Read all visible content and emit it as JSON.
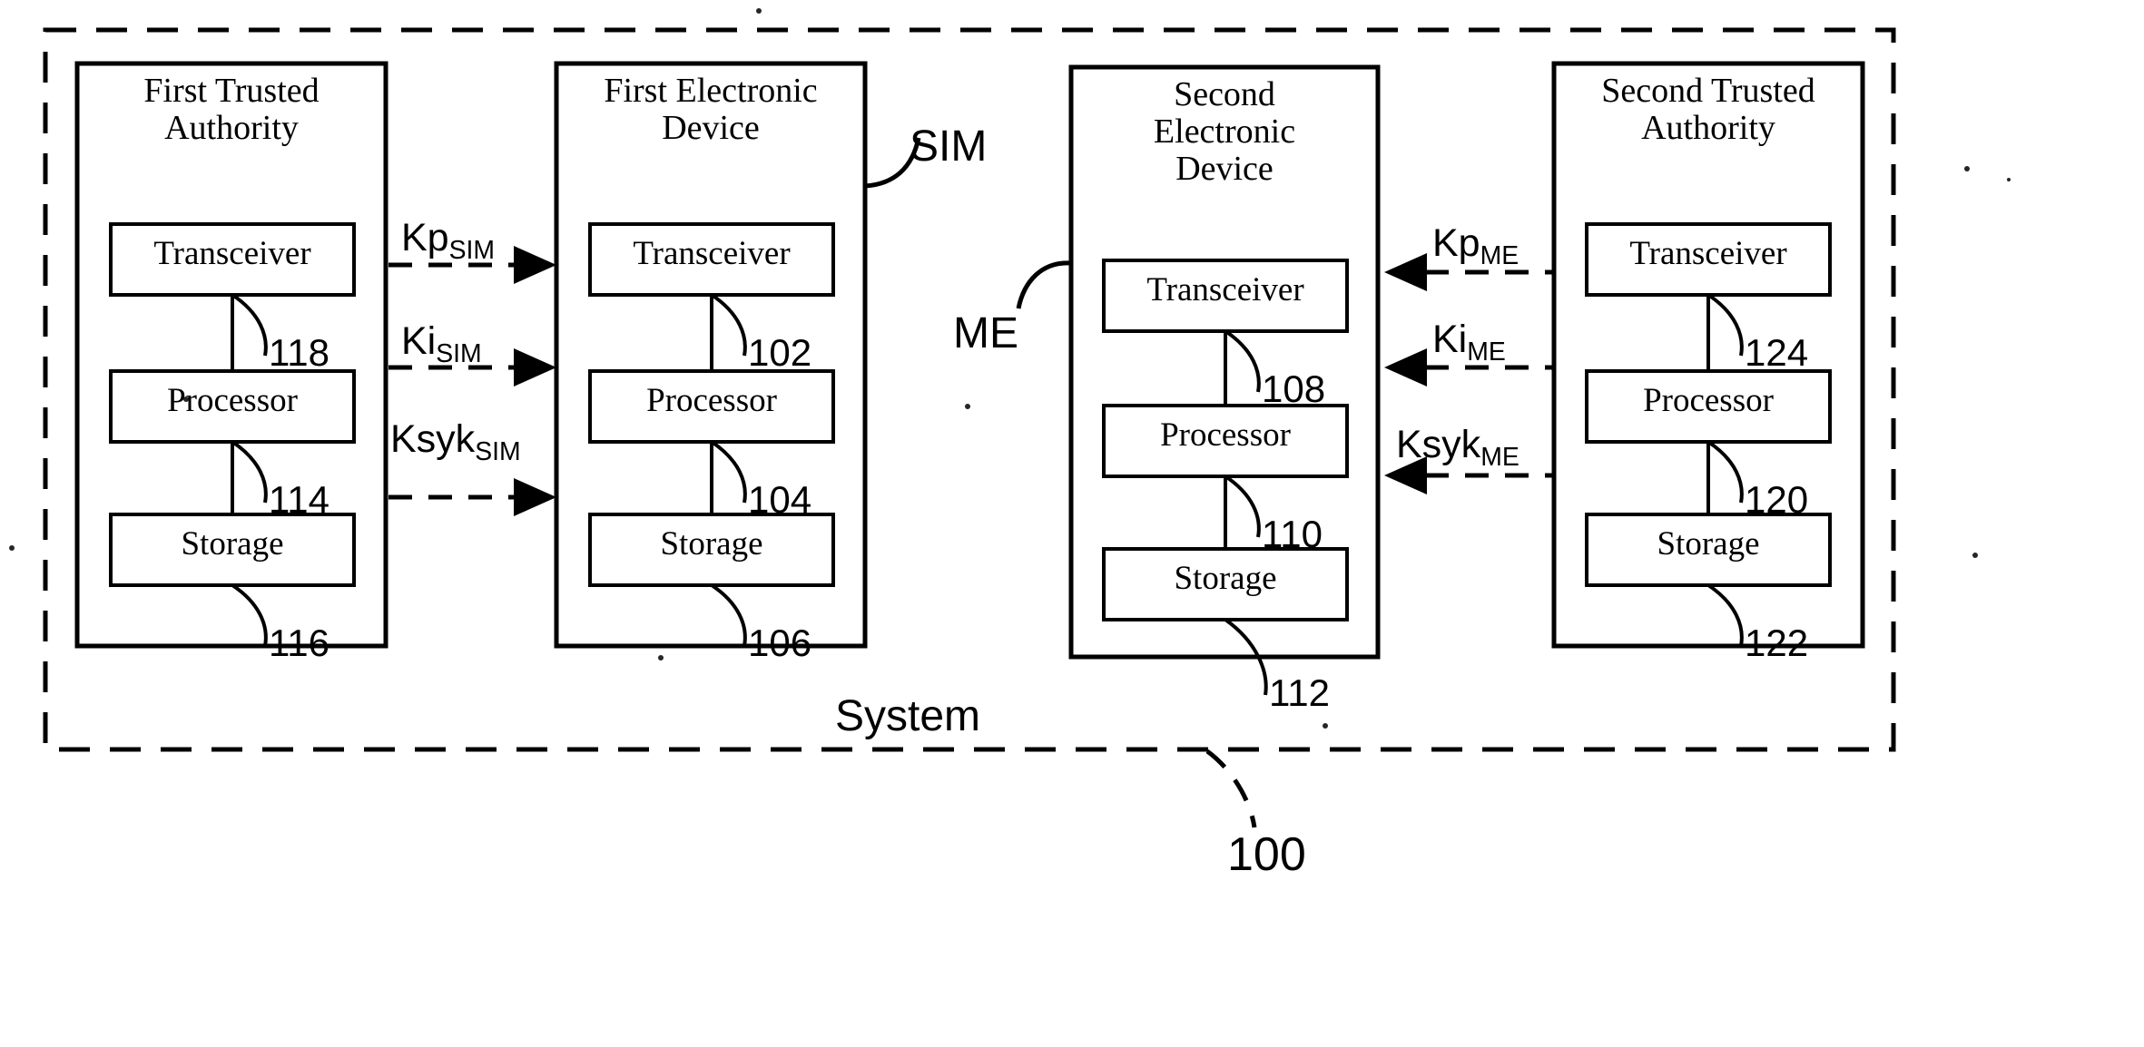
{
  "figure": {
    "system_label": "System",
    "system_ref": "100",
    "sim_label": "SIM",
    "me_label": "ME"
  },
  "blocks": [
    {
      "id": "first-trusted-authority",
      "title_lines": [
        "First Trusted",
        "Authority"
      ],
      "units": [
        {
          "name": "Transceiver",
          "ref": "118"
        },
        {
          "name": "Processor",
          "ref": "114"
        },
        {
          "name": "Storage",
          "ref": "116"
        }
      ]
    },
    {
      "id": "first-electronic-device",
      "title_lines": [
        "First Electronic",
        "Device"
      ],
      "units": [
        {
          "name": "Transceiver",
          "ref": "102"
        },
        {
          "name": "Processor",
          "ref": "104"
        },
        {
          "name": "Storage",
          "ref": "106"
        }
      ]
    },
    {
      "id": "second-electronic-device",
      "title_lines": [
        "Second",
        "Electronic",
        "Device"
      ],
      "units": [
        {
          "name": "Transceiver",
          "ref": "108"
        },
        {
          "name": "Processor",
          "ref": "110"
        },
        {
          "name": "Storage",
          "ref": "112"
        }
      ]
    },
    {
      "id": "second-trusted-authority",
      "title_lines": [
        "Second Trusted",
        "Authority"
      ],
      "units": [
        {
          "name": "Transceiver",
          "ref": "124"
        },
        {
          "name": "Processor",
          "ref": "120"
        },
        {
          "name": "Storage",
          "ref": "122"
        }
      ]
    }
  ],
  "left_keys": [
    {
      "base": "Kp",
      "sub": "SIM",
      "direction": "right"
    },
    {
      "base": "Ki",
      "sub": "SIM",
      "direction": "right"
    },
    {
      "base": "Ksyk",
      "sub": "SIM",
      "direction": "right"
    }
  ],
  "right_keys": [
    {
      "base": "Kp",
      "sub": "ME",
      "direction": "left"
    },
    {
      "base": "Ki",
      "sub": "ME",
      "direction": "left"
    },
    {
      "base": "Ksyk",
      "sub": "ME",
      "direction": "left"
    }
  ],
  "colors": {
    "ink": "#000000",
    "paper": "#ffffff"
  }
}
